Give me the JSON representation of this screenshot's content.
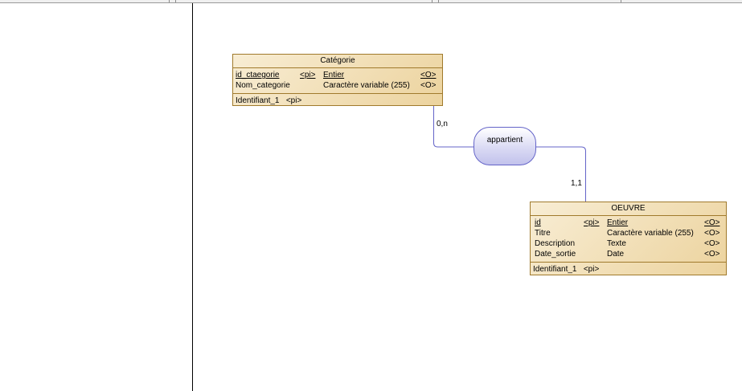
{
  "entities": {
    "categorie": {
      "title": "Catégorie",
      "attributes": [
        {
          "name": "id_ctaegorie",
          "tag": "<pi>",
          "type": "Entier",
          "mandatory": "<O>"
        },
        {
          "name": "Nom_categorie",
          "tag": "",
          "type": "Caractère variable (255)",
          "mandatory": "<O>"
        }
      ],
      "identifier": "Identifiant_1",
      "identifier_tag": "<pi>"
    },
    "oeuvre": {
      "title": "OEUVRE",
      "attributes": [
        {
          "name": "id",
          "tag": "<pi>",
          "type": "Entier",
          "mandatory": "<O>"
        },
        {
          "name": "Titre",
          "tag": "",
          "type": "Caractère variable (255)",
          "mandatory": "<O>"
        },
        {
          "name": "Description",
          "tag": "",
          "type": "Texte",
          "mandatory": "<O>"
        },
        {
          "name": "Date_sortie",
          "tag": "",
          "type": "Date",
          "mandatory": "<O>"
        }
      ],
      "identifier": "Identifiant_1",
      "identifier_tag": "<pi>"
    }
  },
  "relationship": {
    "label": "appartient",
    "cardinality_categorie": "0,n",
    "cardinality_oeuvre": "1,1"
  },
  "colors": {
    "entity_border": "#a07a2c",
    "entity_fill": "#ecd39e",
    "relationship_border": "#6464c8",
    "relationship_fill": "#dadaf4",
    "connector": "#6464c8"
  }
}
